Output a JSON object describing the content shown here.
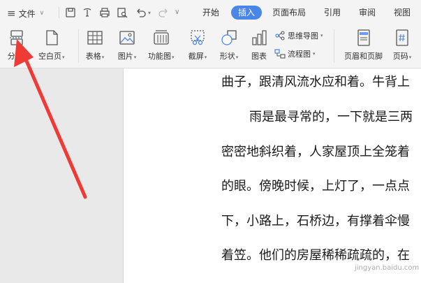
{
  "menubar": {
    "file_label": "文件",
    "tabs": [
      "开始",
      "插入",
      "页面布局",
      "引用",
      "审阅",
      "视图"
    ],
    "active_tab": "插入"
  },
  "ribbon": {
    "fenye": "分页",
    "blank_page": "空白页",
    "table": "表格",
    "picture": "图片",
    "function_chart": "功能图",
    "screenshot": "截屏",
    "shape": "形状",
    "chart": "图表",
    "mindmap": "思维导图",
    "flowchart": "流程图",
    "header_footer": "页眉和页脚",
    "page_number": "页码"
  },
  "document": {
    "lines": [
      "曲子，跟清风流水应和着。牛背上",
      "雨是最寻常的，一下就是三两",
      "密密地斜织着，人家屋顶上全笼着",
      "的眼。傍晚时候，上灯了，一点点",
      "下，小路上，石桥边，有撑着伞慢",
      "着笠。他们的房屋稀稀疏疏的，在"
    ]
  },
  "watermark": "jingyan.baidu.com",
  "colors": {
    "accent": "#4a86e8",
    "arrow": "#f03a35",
    "icon": "#4a86e8"
  }
}
